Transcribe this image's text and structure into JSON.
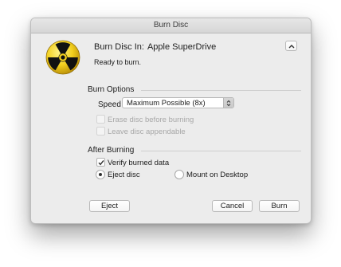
{
  "window": {
    "title": "Burn Disc"
  },
  "header": {
    "burn_disc_in_label": "Burn Disc In:",
    "drive_name": "Apple SuperDrive",
    "status": "Ready to burn.",
    "collapse_icon": "chevron-up-icon"
  },
  "burn_options": {
    "section_title": "Burn Options",
    "speed_label": "Speed",
    "speed_value": "Maximum Possible (8x)",
    "erase_label": "Erase disc before burning",
    "erase_checked": false,
    "erase_enabled": false,
    "appendable_label": "Leave disc appendable",
    "appendable_checked": false,
    "appendable_enabled": false
  },
  "after_burning": {
    "section_title": "After Burning",
    "verify_label": "Verify burned data",
    "verify_checked": true,
    "eject_label": "Eject disc",
    "mount_label": "Mount on Desktop",
    "selected": "eject"
  },
  "footer": {
    "eject_button": "Eject",
    "cancel_button": "Cancel",
    "burn_button": "Burn"
  },
  "icons": {
    "app_icon": "burn-hazard-icon"
  },
  "colors": {
    "window_bg": "#ececec",
    "hazard_yellow": "#f2cf1d",
    "hazard_black": "#111111"
  }
}
